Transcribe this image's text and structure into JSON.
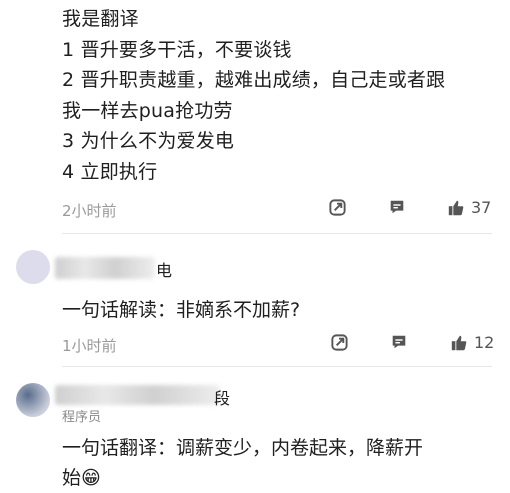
{
  "comment1": {
    "lines": [
      "我是翻译",
      "1 晋升要多干活，不要谈钱",
      "2 晋升职责越重，越难出成绩，自己走或者跟",
      "我一样去pua抢功劳",
      "3 为什么不为爱发电",
      "4 立即执行"
    ],
    "time": "2小时前",
    "likes": "37"
  },
  "comment2": {
    "name_visible": "电",
    "text": "一句话解读：非嫡系不加薪?",
    "time": "1小时前",
    "likes": "12"
  },
  "comment3": {
    "name_visible": "段",
    "role": "程序员",
    "text_line1": "一句话翻译：调薪变少，内卷起来，降薪开",
    "text_line2": "始",
    "emoji": "😁"
  },
  "colors": {
    "text": "#1f1f1f",
    "meta": "#9a9a9a",
    "icon": "#555555",
    "divider": "#e6e6e6"
  },
  "icons": [
    "share-icon",
    "comment-icon",
    "thumbs-up-icon"
  ]
}
